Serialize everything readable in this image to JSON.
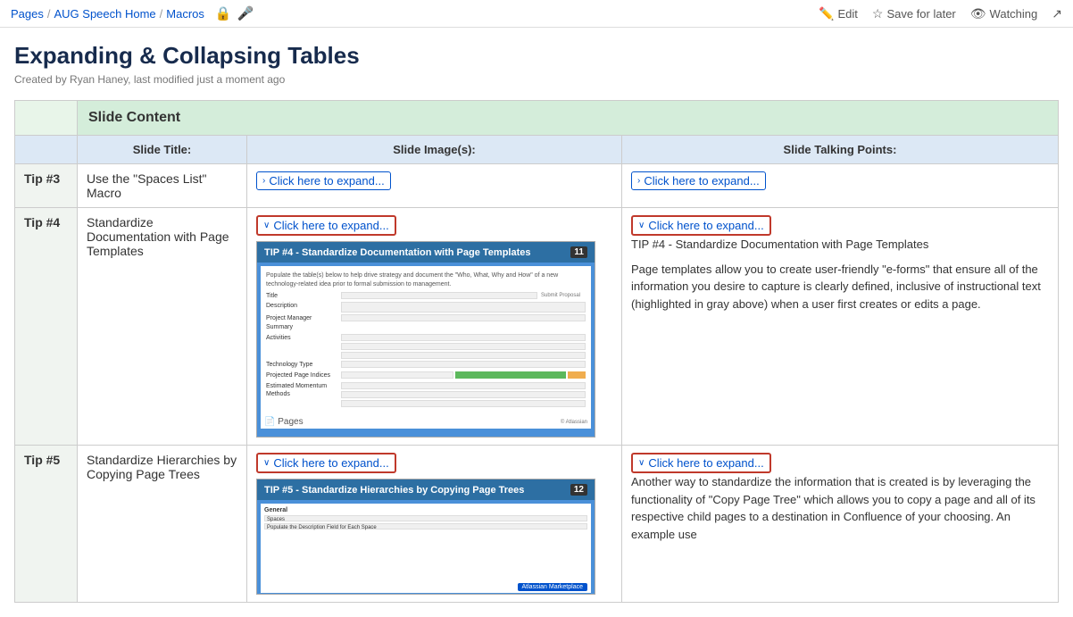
{
  "breadcrumb": {
    "pages": "Pages",
    "aug": "AUG Speech Home",
    "macros": "Macros",
    "sep": "/"
  },
  "nav_actions": {
    "edit": "Edit",
    "save_for_later": "Save for later",
    "watching": "Watching"
  },
  "page": {
    "title": "Expanding & Collapsing Tables",
    "meta": "Created by Ryan Haney, last modified just a moment ago"
  },
  "table": {
    "section_header": "Slide Content",
    "col_headers": {
      "tip": "",
      "title": "Slide Title:",
      "images": "Slide Image(s):",
      "talking": "Slide Talking Points:"
    },
    "rows": [
      {
        "tip": "Tip #3",
        "title": "Use the \"Spaces List\" Macro",
        "images_expand": "Click here to expand...",
        "images_expanded": false,
        "talking_expand": "Click here to expand...",
        "talking_expanded": false
      },
      {
        "tip": "Tip #4",
        "title": "Standardize Documentation with Page Templates",
        "images_expand": "Click here to expand...",
        "images_expanded": true,
        "slide_title": "TIP #4 - Standardize Documentation with Page Templates",
        "slide_number": "11",
        "talking_expand": "Click here to expand...",
        "talking_expanded": true,
        "talking_header": "TIP #4 - Standardize Documentation with Page Templates",
        "talking_body": "Page templates allow you to create user-friendly \"e-forms\" that ensure all of the information you desire to capture is clearly defined, inclusive of instructional text (highlighted in gray above) when a user first creates or edits a page."
      },
      {
        "tip": "Tip #5",
        "title": "Standardize Hierarchies by Copying Page Trees",
        "images_expand": "Click here to expand...",
        "images_expanded": true,
        "slide_title": "TIP #5 - Standardize Hierarchies by Copying Page Trees",
        "slide_number": "12",
        "talking_expand": "Click here to expand...",
        "talking_expanded": true,
        "talking_body": "Another way to standardize the information that is created is by leveraging the functionality of \"Copy Page Tree\" which allows you to copy a page and all of its respective child pages to a destination in Confluence of your choosing.  An example use"
      }
    ]
  }
}
